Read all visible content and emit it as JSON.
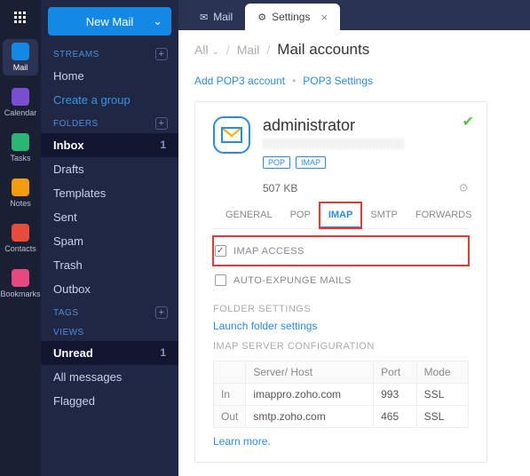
{
  "rail": [
    {
      "name": "apps",
      "label": "",
      "ico": "grid",
      "color": ""
    },
    {
      "name": "mail",
      "label": "Mail",
      "ico": "mail",
      "color": "#1389e5",
      "active": true
    },
    {
      "name": "calendar",
      "label": "Calendar",
      "ico": "cal",
      "color": "#7a4ed1"
    },
    {
      "name": "tasks",
      "label": "Tasks",
      "ico": "task",
      "color": "#2bb673"
    },
    {
      "name": "notes",
      "label": "Notes",
      "ico": "note",
      "color": "#f39c12"
    },
    {
      "name": "contacts",
      "label": "Contacts",
      "ico": "contact",
      "color": "#e74c3c"
    },
    {
      "name": "bookmarks",
      "label": "Bookmarks",
      "ico": "bm",
      "color": "#e64980"
    }
  ],
  "newMail": "New Mail",
  "sections": {
    "streams": {
      "title": "STREAMS",
      "items": [
        {
          "label": "Home"
        },
        {
          "label": "Create a group",
          "accent": true
        }
      ]
    },
    "folders": {
      "title": "FOLDERS",
      "items": [
        {
          "label": "Inbox",
          "count": "1",
          "sel": true
        },
        {
          "label": "Drafts"
        },
        {
          "label": "Templates"
        },
        {
          "label": "Sent"
        },
        {
          "label": "Spam"
        },
        {
          "label": "Trash"
        },
        {
          "label": "Outbox"
        }
      ]
    },
    "tags": {
      "title": "TAGS",
      "items": []
    },
    "views": {
      "title": "VIEWS",
      "items": [
        {
          "label": "Unread",
          "count": "1",
          "sel": true
        },
        {
          "label": "All messages"
        },
        {
          "label": "Flagged"
        }
      ]
    }
  },
  "tabs": [
    {
      "label": "Mail",
      "icon": "mail"
    },
    {
      "label": "Settings",
      "icon": "gear",
      "active": true,
      "closable": true
    }
  ],
  "breadcrumb": [
    "All",
    "Mail",
    "Mail accounts"
  ],
  "actions": [
    "Add POP3 account",
    "POP3 Settings"
  ],
  "account": {
    "name": "administrator",
    "badges": [
      "POP",
      "IMAP"
    ],
    "storage": "507 KB",
    "subtabs": [
      "GENERAL",
      "POP",
      "IMAP",
      "SMTP",
      "FORWARDS"
    ],
    "activeSubtab": 2,
    "imapAccess": {
      "label": "IMAP ACCESS",
      "checked": true
    },
    "autoExpunge": {
      "label": "AUTO-EXPUNGE MAILS",
      "checked": false
    },
    "folderSettings": {
      "title": "FOLDER SETTINGS",
      "link": "Launch folder settings"
    },
    "serverConfig": {
      "title": "IMAP SERVER CONFIGURATION",
      "headers": [
        "",
        "Server/ Host",
        "Port",
        "Mode"
      ],
      "rows": [
        [
          "In",
          "imappro.zoho.com",
          "993",
          "SSL"
        ],
        [
          "Out",
          "smtp.zoho.com",
          "465",
          "SSL"
        ]
      ]
    },
    "learnMore": "Learn more."
  }
}
